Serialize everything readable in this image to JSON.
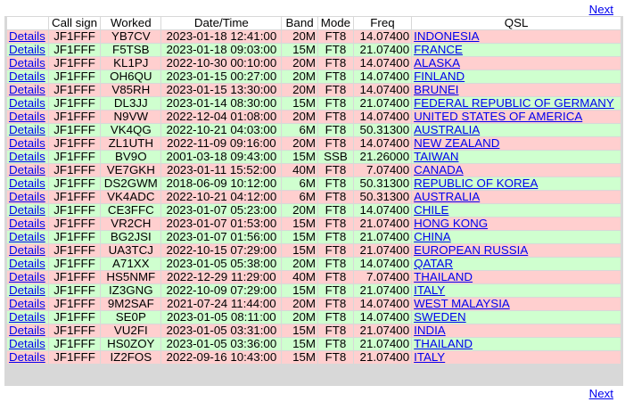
{
  "nav": {
    "next_label": "Next"
  },
  "table": {
    "headers": {
      "details": "",
      "callsign": "Call sign",
      "worked": "Worked",
      "datetime": "Date/Time",
      "band": "Band",
      "mode": "Mode",
      "freq": "Freq",
      "qsl": "QSL"
    },
    "row_colors": {
      "odd": "#ffcfcf",
      "even": "#cfffcf"
    },
    "rows": [
      {
        "details": "Details",
        "callsign": "JF1FFF",
        "worked": "YB7CV",
        "datetime": "2023-01-18 12:41:00",
        "band": "20M",
        "mode": "FT8",
        "freq": "14.07400",
        "qsl": "INDONESIA"
      },
      {
        "details": "Details",
        "callsign": "JF1FFF",
        "worked": "F5TSB",
        "datetime": "2023-01-18 09:03:00",
        "band": "15M",
        "mode": "FT8",
        "freq": "21.07400",
        "qsl": "FRANCE"
      },
      {
        "details": "Details",
        "callsign": "JF1FFF",
        "worked": "KL1PJ",
        "datetime": "2022-10-30 00:10:00",
        "band": "20M",
        "mode": "FT8",
        "freq": "14.07400",
        "qsl": "ALASKA"
      },
      {
        "details": "Details",
        "callsign": "JF1FFF",
        "worked": "OH6QU",
        "datetime": "2023-01-15 00:27:00",
        "band": "20M",
        "mode": "FT8",
        "freq": "14.07400",
        "qsl": "FINLAND"
      },
      {
        "details": "Details",
        "callsign": "JF1FFF",
        "worked": "V85RH",
        "datetime": "2023-01-15 13:30:00",
        "band": "20M",
        "mode": "FT8",
        "freq": "14.07400",
        "qsl": "BRUNEI"
      },
      {
        "details": "Details",
        "callsign": "JF1FFF",
        "worked": "DL3JJ",
        "datetime": "2023-01-14 08:30:00",
        "band": "15M",
        "mode": "FT8",
        "freq": "21.07400",
        "qsl": "FEDERAL REPUBLIC OF GERMANY"
      },
      {
        "details": "Details",
        "callsign": "JF1FFF",
        "worked": "N9VW",
        "datetime": "2022-12-04 01:08:00",
        "band": "20M",
        "mode": "FT8",
        "freq": "14.07400",
        "qsl": "UNITED STATES OF AMERICA"
      },
      {
        "details": "Details",
        "callsign": "JF1FFF",
        "worked": "VK4QG",
        "datetime": "2022-10-21 04:03:00",
        "band": "6M",
        "mode": "FT8",
        "freq": "50.31300",
        "qsl": "AUSTRALIA"
      },
      {
        "details": "Details",
        "callsign": "JF1FFF",
        "worked": "ZL1UTH",
        "datetime": "2022-11-09 09:16:00",
        "band": "20M",
        "mode": "FT8",
        "freq": "14.07400",
        "qsl": "NEW ZEALAND"
      },
      {
        "details": "Details",
        "callsign": "JF1FFF",
        "worked": "BV9O",
        "datetime": "2001-03-18 09:43:00",
        "band": "15M",
        "mode": "SSB",
        "freq": "21.26000",
        "qsl": "TAIWAN"
      },
      {
        "details": "Details",
        "callsign": "JF1FFF",
        "worked": "VE7GKH",
        "datetime": "2023-01-11 15:52:00",
        "band": "40M",
        "mode": "FT8",
        "freq": "7.07400",
        "qsl": "CANADA"
      },
      {
        "details": "Details",
        "callsign": "JF1FFF",
        "worked": "DS2GWM",
        "datetime": "2018-06-09 10:12:00",
        "band": "6M",
        "mode": "FT8",
        "freq": "50.31300",
        "qsl": "REPUBLIC OF KOREA"
      },
      {
        "details": "Details",
        "callsign": "JF1FFF",
        "worked": "VK4ADC",
        "datetime": "2022-10-21 04:12:00",
        "band": "6M",
        "mode": "FT8",
        "freq": "50.31300",
        "qsl": "AUSTRALIA"
      },
      {
        "details": "Details",
        "callsign": "JF1FFF",
        "worked": "CE3FFC",
        "datetime": "2023-01-07 05:23:00",
        "band": "20M",
        "mode": "FT8",
        "freq": "14.07400",
        "qsl": "CHILE"
      },
      {
        "details": "Details",
        "callsign": "JF1FFF",
        "worked": "VR2CH",
        "datetime": "2023-01-07 01:53:00",
        "band": "15M",
        "mode": "FT8",
        "freq": "21.07400",
        "qsl": "HONG KONG"
      },
      {
        "details": "Details",
        "callsign": "JF1FFF",
        "worked": "BG2JSI",
        "datetime": "2023-01-07 01:56:00",
        "band": "15M",
        "mode": "FT8",
        "freq": "21.07400",
        "qsl": "CHINA"
      },
      {
        "details": "Details",
        "callsign": "JF1FFF",
        "worked": "UA3TCJ",
        "datetime": "2022-10-15 07:29:00",
        "band": "15M",
        "mode": "FT8",
        "freq": "21.07400",
        "qsl": "EUROPEAN RUSSIA"
      },
      {
        "details": "Details",
        "callsign": "JF1FFF",
        "worked": "A71XX",
        "datetime": "2023-01-05 05:38:00",
        "band": "20M",
        "mode": "FT8",
        "freq": "14.07400",
        "qsl": "QATAR"
      },
      {
        "details": "Details",
        "callsign": "JF1FFF",
        "worked": "HS5NMF",
        "datetime": "2022-12-29 11:29:00",
        "band": "40M",
        "mode": "FT8",
        "freq": "7.07400",
        "qsl": "THAILAND"
      },
      {
        "details": "Details",
        "callsign": "JF1FFF",
        "worked": "IZ3GNG",
        "datetime": "2022-10-09 07:29:00",
        "band": "15M",
        "mode": "FT8",
        "freq": "21.07400",
        "qsl": "ITALY"
      },
      {
        "details": "Details",
        "callsign": "JF1FFF",
        "worked": "9M2SAF",
        "datetime": "2021-07-24 11:44:00",
        "band": "20M",
        "mode": "FT8",
        "freq": "14.07400",
        "qsl": "WEST MALAYSIA"
      },
      {
        "details": "Details",
        "callsign": "JF1FFF",
        "worked": "SE0P",
        "datetime": "2023-01-05 08:11:00",
        "band": "20M",
        "mode": "FT8",
        "freq": "14.07400",
        "qsl": "SWEDEN"
      },
      {
        "details": "Details",
        "callsign": "JF1FFF",
        "worked": "VU2FI",
        "datetime": "2023-01-05 03:31:00",
        "band": "15M",
        "mode": "FT8",
        "freq": "21.07400",
        "qsl": "INDIA"
      },
      {
        "details": "Details",
        "callsign": "JF1FFF",
        "worked": "HS0ZOY",
        "datetime": "2023-01-05 03:36:00",
        "band": "15M",
        "mode": "FT8",
        "freq": "21.07400",
        "qsl": "THAILAND"
      },
      {
        "details": "Details",
        "callsign": "JF1FFF",
        "worked": "IZ2FOS",
        "datetime": "2022-09-16 10:43:00",
        "band": "15M",
        "mode": "FT8",
        "freq": "21.07400",
        "qsl": "ITALY"
      }
    ]
  }
}
